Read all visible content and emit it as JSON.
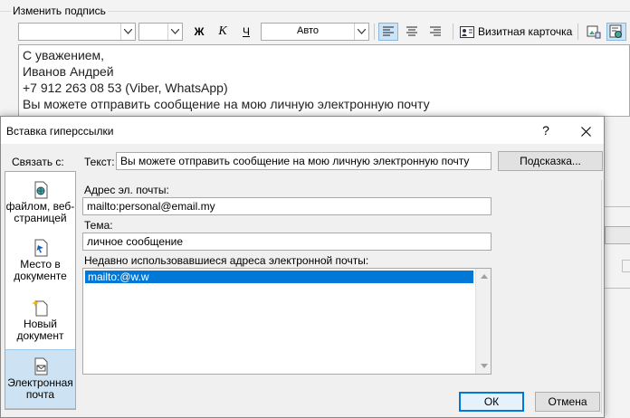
{
  "editor": {
    "group_label": "Изменить подпись",
    "font_size_value": "",
    "color_value": "Авто",
    "bold_label": "Ж",
    "italic_label": "К",
    "underline_label": "Ч",
    "vcard_label": "Визитная карточка",
    "lines": [
      "С уважением,",
      "Иванов Андрей",
      "+7 912 263 08 53 (Viber, WhatsApp)",
      "Вы можете отправить сообщение на мою личную электронную почту"
    ]
  },
  "dialog": {
    "title": "Вставка гиперссылки",
    "help_glyph": "?",
    "link_with_label": "Связать с:",
    "sidebar": [
      {
        "line1": "файлом, веб-",
        "line2": "страницей",
        "icon": "web-page-icon"
      },
      {
        "line1": "Место в",
        "line2": "документе",
        "icon": "place-in-document-icon"
      },
      {
        "line1": "Новый",
        "line2": "документ",
        "icon": "new-document-icon"
      },
      {
        "line1": "Электронная",
        "line2": "почта",
        "icon": "email-icon",
        "active": true
      }
    ],
    "text_label": "Текст:",
    "text_value": "Вы можете отправить сообщение на мою личную электронную почту",
    "tooltip_button": "Подсказка...",
    "email_label": "Адрес эл. почты:",
    "email_value": "mailto:personal@email.my",
    "subject_label": "Тема:",
    "subject_value": "личное сообщение",
    "recent_label": "Недавно использовавшиеся адреса электронной почты:",
    "recent_items": [
      "mailto:@w.w"
    ],
    "ok_button": "ОК",
    "cancel_button": "Отмена"
  },
  "colors": {
    "selection": "#0078d7",
    "active_sidebar": "#cde3f3"
  }
}
